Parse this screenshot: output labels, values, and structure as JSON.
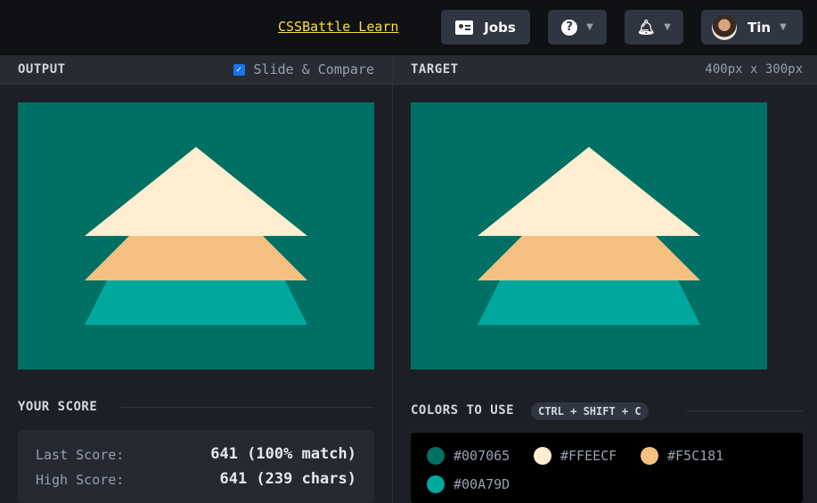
{
  "header": {
    "learn_link": "CSSBattle Learn",
    "jobs_label": "Jobs",
    "user_name": "Tin"
  },
  "output_panel": {
    "title": "OUTPUT",
    "slide_compare_label": "Slide & Compare",
    "slide_compare_checked": true
  },
  "target_panel": {
    "title": "TARGET",
    "dimensions": "400px x 300px"
  },
  "score": {
    "title": "YOUR SCORE",
    "last_label": "Last Score:",
    "last_value": "641 (100% match)",
    "high_label": "High Score:",
    "high_value": "641 (239 chars)"
  },
  "colors": {
    "title": "COLORS TO USE",
    "shortcut": "CTRL + SHIFT + C",
    "list": [
      {
        "hex": "#007065",
        "label": "#007065"
      },
      {
        "hex": "#FFEECF",
        "label": "#FFEECF"
      },
      {
        "hex": "#F5C181",
        "label": "#F5C181"
      },
      {
        "hex": "#00A79D",
        "label": "#00A79D"
      }
    ]
  },
  "theme": {
    "canvas_bg": "#007065",
    "top_triangle": "#FFEECF",
    "middle_band": "#F5C181",
    "bottom_band": "#00A79D",
    "link_color": "#ffdd40"
  }
}
